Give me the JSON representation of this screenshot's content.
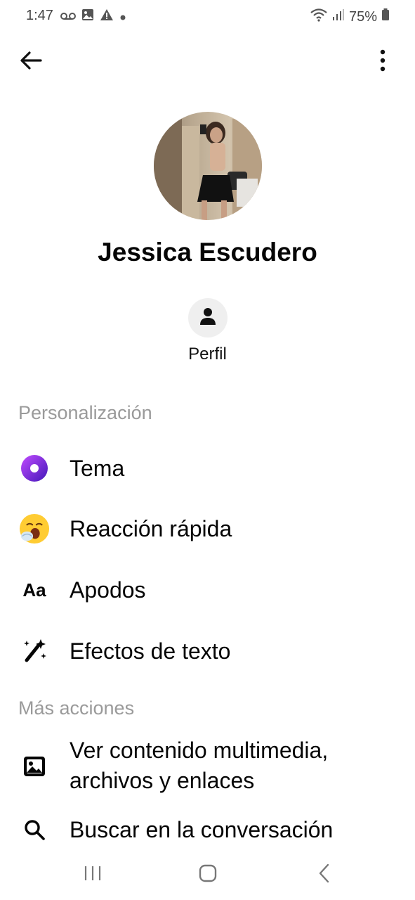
{
  "status_bar": {
    "time": "1:47",
    "battery": "75%",
    "icons": [
      "voicemail-icon",
      "gallery-icon",
      "alert-icon",
      "dot-icon",
      "wifi-icon",
      "signal-icon",
      "battery-icon"
    ]
  },
  "profile": {
    "name": "Jessica Escudero",
    "profile_button_label": "Perfil"
  },
  "sections": {
    "personalization_title": "Personalización",
    "more_actions_title": "Más acciones"
  },
  "personalization_items": [
    {
      "label": "Tema",
      "icon": "theme-icon"
    },
    {
      "label": "Reacción rápida",
      "icon": "yawning-face-emoji-icon"
    },
    {
      "label": "Apodos",
      "icon": "nickname-aa-icon"
    },
    {
      "label": "Efectos de texto",
      "icon": "magic-wand-icon"
    }
  ],
  "more_actions_items": [
    {
      "label_line1": "Ver contenido multimedia,",
      "label_line2": "archivos y enlaces",
      "icon": "image-icon"
    },
    {
      "label": "Buscar en la conversación",
      "icon": "search-icon"
    }
  ],
  "colors": {
    "theme_gradient_start": "#a033ff",
    "theme_gradient_end": "#4a1fbf",
    "section_header": "#9a9a9a",
    "profile_button_bg": "#efefef"
  }
}
